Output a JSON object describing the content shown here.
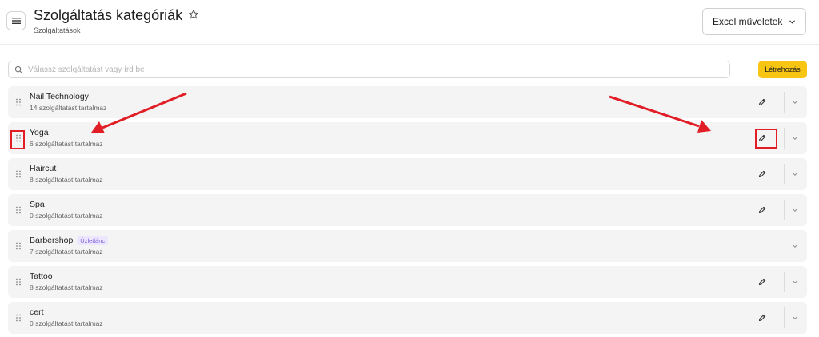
{
  "header": {
    "title": "Szolgáltatás kategóriák",
    "subtitle": "Szolgáltatások",
    "excel_button_label": "Excel műveletek"
  },
  "search": {
    "placeholder": "Válassz szolgáltatást vagy írd be",
    "value": ""
  },
  "actions": {
    "create_label": "Létrehozás"
  },
  "categories": [
    {
      "name": "Nail Technology",
      "count_text": "14 szolgáltatást tartalmaz",
      "badge": "",
      "editable": true
    },
    {
      "name": "Yoga",
      "count_text": "6 szolgáltatást tartalmaz",
      "badge": "",
      "editable": true
    },
    {
      "name": "Haircut",
      "count_text": "8 szolgáltatást tartalmaz",
      "badge": "",
      "editable": true
    },
    {
      "name": "Spa",
      "count_text": "0 szolgáltatást tartalmaz",
      "badge": "",
      "editable": true
    },
    {
      "name": "Barbershop",
      "count_text": "7 szolgáltatást tartalmaz",
      "badge": "Üzletlánc",
      "editable": false
    },
    {
      "name": "Tattoo",
      "count_text": "8 szolgáltatást tartalmaz",
      "badge": "",
      "editable": true
    },
    {
      "name": "cert",
      "count_text": "0 szolgáltatást tartalmaz",
      "badge": "",
      "editable": true
    }
  ],
  "colors": {
    "accent": "#f9c513",
    "annotation": "#e11e26",
    "row_background": "#f4f4f4",
    "badge_text": "#7b5cd6",
    "badge_background": "#ece6ff"
  },
  "icons": {
    "menu": "hamburger-menu-icon",
    "favorite": "star-outline-icon",
    "dropdown": "chevron-down-icon",
    "search": "search-icon",
    "drag": "drag-handle-icon",
    "edit": "pencil-icon",
    "expand": "chevron-down-icon"
  }
}
